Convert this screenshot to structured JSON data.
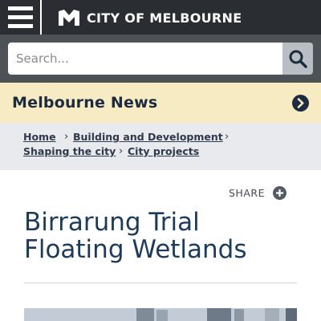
{
  "header": {
    "brand_name": "CITY OF MELBOURNE",
    "menu_icon": "hamburger-menu-icon",
    "logo_icon": "city-m-logo-icon"
  },
  "search": {
    "placeholder": "Search...",
    "value": "",
    "button_icon": "search-icon"
  },
  "news_bar": {
    "title": "Melbourne News",
    "arrow_icon": "chevron-right-circle-icon"
  },
  "breadcrumb": {
    "items": [
      {
        "label": "Home"
      },
      {
        "label": "Building and Development"
      },
      {
        "label": "Shaping the city"
      },
      {
        "label": "City projects"
      }
    ]
  },
  "share": {
    "label": "SHARE",
    "icon": "plus-circle-icon"
  },
  "article": {
    "title": "Birrarung Trial Floating Wetlands"
  },
  "colors": {
    "topbar": "#2a2d32",
    "search_bg": "#4d5256",
    "news_bar": "#f7ebc4",
    "breadcrumb_bg": "#e8eaed",
    "title_color": "#1c3a5a"
  }
}
